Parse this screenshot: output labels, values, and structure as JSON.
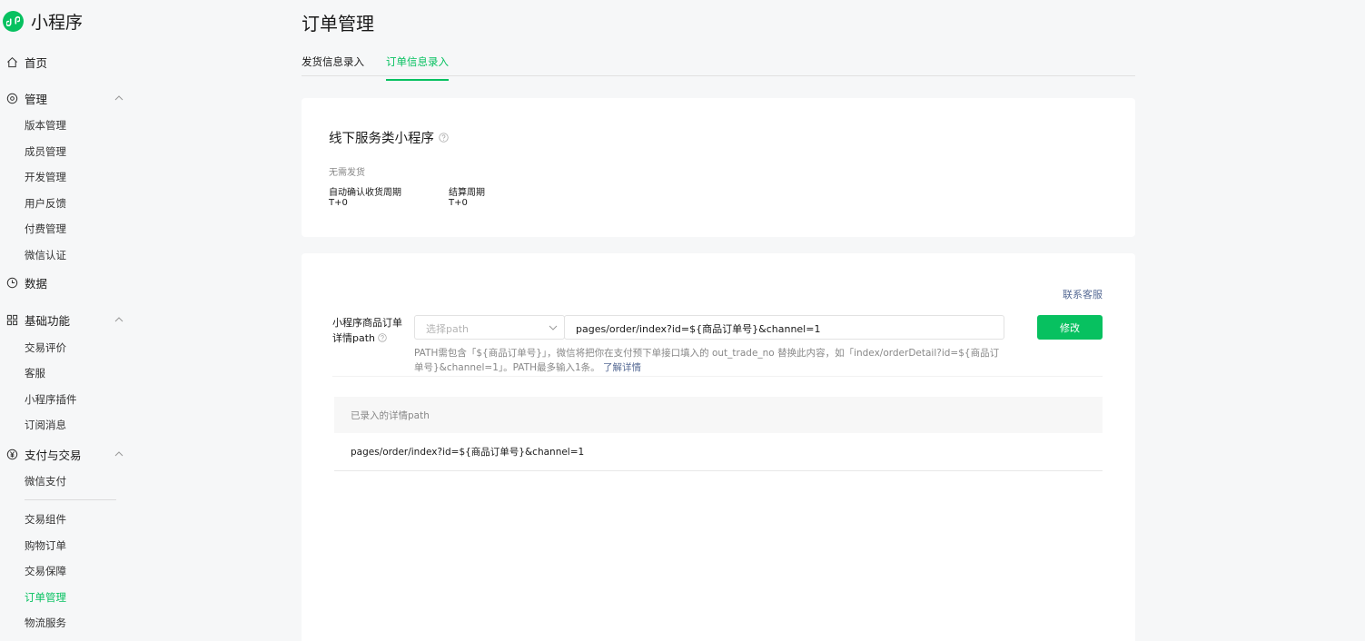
{
  "app": {
    "title": "小程序",
    "brand_color": "#07c160",
    "link_color": "#576b95"
  },
  "sidebar": {
    "home": {
      "label": "首页",
      "icon": "home-icon"
    },
    "manage": {
      "label": "管理",
      "icon": "settings-icon",
      "items": [
        "版本管理",
        "成员管理",
        "开发管理",
        "用户反馈",
        "付费管理",
        "微信认证"
      ]
    },
    "data": {
      "label": "数据",
      "icon": "clock-icon"
    },
    "basic": {
      "label": "基础功能",
      "icon": "grid-icon",
      "items": [
        "交易评价",
        "客服",
        "小程序插件",
        "订阅消息"
      ]
    },
    "pay": {
      "label": "支付与交易",
      "icon": "yen-icon",
      "items_a": [
        "微信支付"
      ],
      "items_b": [
        "交易组件",
        "购物订单",
        "交易保障",
        "订单管理",
        "物流服务"
      ],
      "active_item": "订单管理"
    }
  },
  "page": {
    "title": "订单管理",
    "tabs": [
      {
        "label": "发货信息录入",
        "active": false
      },
      {
        "label": "订单信息录入",
        "active": true
      }
    ]
  },
  "service_card": {
    "title": "线下服务类小程序",
    "subtitle": "无需发货",
    "fields": [
      {
        "label": "自动确认收货周期",
        "value": "T+0"
      },
      {
        "label": "结算周期",
        "value": "T+0"
      }
    ]
  },
  "path_card": {
    "contact_link": "联系客服",
    "form": {
      "label": "小程序商品订单详情path",
      "select_placeholder": "选择path",
      "path_value": "pages/order/index?id=${商品订单号}&channel=1",
      "submit_label": "修改",
      "hint": "PATH需包含「${商品订单号}」，微信将把你在支付预下单接口填入的 out_trade_no 替换此内容，如「index/orderDetail?id=${商品订单号}&channel=1」。PATH最多输入1条。",
      "hint_link": "了解详情"
    },
    "table": {
      "header": "已录入的详情path",
      "rows": [
        "pages/order/index?id=${商品订单号}&channel=1"
      ]
    }
  }
}
